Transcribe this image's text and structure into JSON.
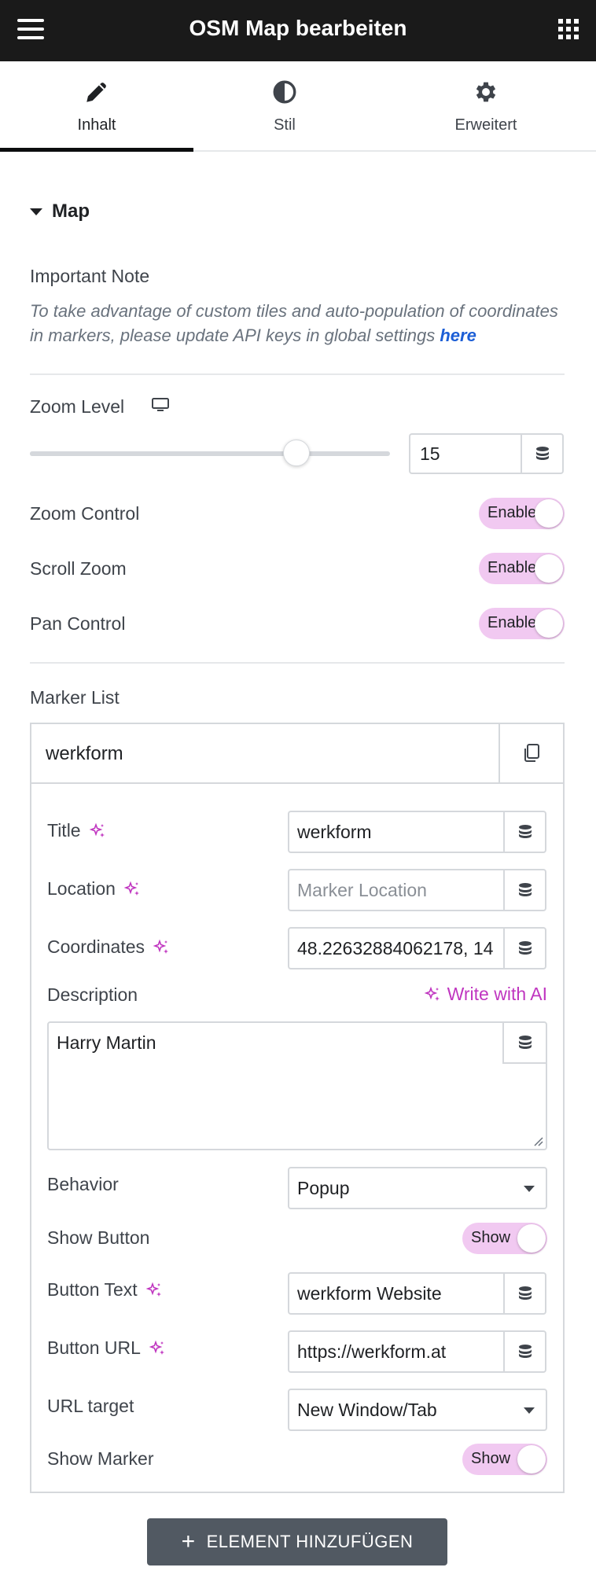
{
  "header": {
    "title": "OSM Map bearbeiten",
    "menu_icon": "hamburger-icon",
    "apps_icon": "grid-icon"
  },
  "tabs": [
    {
      "label": "Inhalt",
      "icon": "pencil-icon",
      "active": true
    },
    {
      "label": "Stil",
      "icon": "contrast-icon",
      "active": false
    },
    {
      "label": "Erweitert",
      "icon": "gear-icon",
      "active": false
    }
  ],
  "section": {
    "title": "Map"
  },
  "important_note": {
    "label": "Important Note",
    "text": "To take advantage of custom tiles and auto-population of coordinates in markers, please update API keys in global settings ",
    "link_text": "here"
  },
  "zoom": {
    "label": "Zoom Level",
    "value": "15",
    "slider_fraction": 0.74
  },
  "toggles": [
    {
      "label": "Zoom Control",
      "state": "Enable"
    },
    {
      "label": "Scroll Zoom",
      "state": "Enable"
    },
    {
      "label": "Pan Control",
      "state": "Enable"
    }
  ],
  "marker_list": {
    "label": "Marker List",
    "item_title": "werkform",
    "title_field": {
      "label": "Title",
      "value": "werkform"
    },
    "location_field": {
      "label": "Location",
      "placeholder": "Marker Location"
    },
    "coordinates_field": {
      "label": "Coordinates",
      "value": "48.22632884062178, 14"
    },
    "description": {
      "label": "Description",
      "ai_label": "Write with AI",
      "value": "Harry Martin"
    },
    "behavior": {
      "label": "Behavior",
      "value": "Popup"
    },
    "show_button": {
      "label": "Show Button",
      "state": "Show"
    },
    "button_text": {
      "label": "Button Text",
      "value": "werkform Website"
    },
    "button_url": {
      "label": "Button URL",
      "value": "https://werkform.at"
    },
    "url_target": {
      "label": "URL target",
      "value": "New Window/Tab"
    },
    "show_marker": {
      "label": "Show Marker",
      "state": "Show"
    }
  },
  "add_button": {
    "label": "ELEMENT HINZUFÜGEN"
  },
  "colors": {
    "accent_toggle": "#f1c9f1",
    "ai_purple": "#c036c0",
    "link_blue": "#1c5ed6",
    "topbar": "#1a1a1a",
    "add_button": "#515962"
  }
}
